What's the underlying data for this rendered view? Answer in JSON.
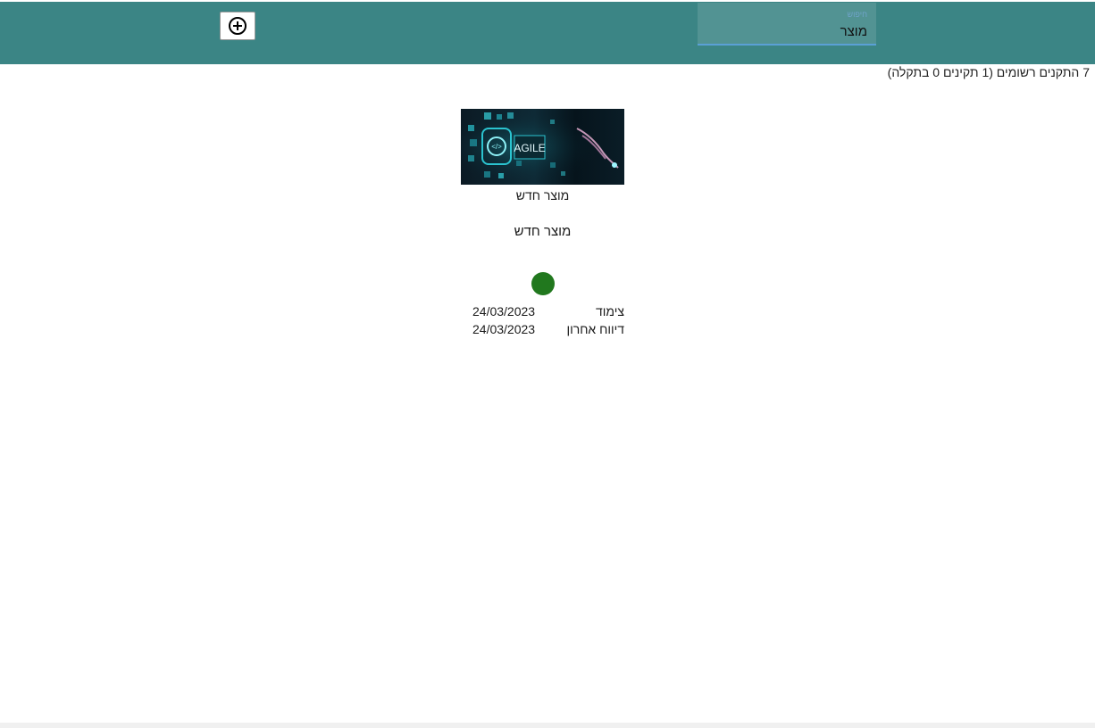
{
  "search": {
    "label": "חיפוש",
    "value": "מוצר"
  },
  "toolbar": {
    "add_icon": "plus-circle-icon"
  },
  "summary": {
    "text": "7 התקנים רשומים (1 תקינים 0 בתקלה)"
  },
  "card": {
    "image_text": "AGILE",
    "image_caption": "מוצר חדש",
    "title": "מוצר חדש",
    "status_color": "#21781e",
    "rows": [
      {
        "label": "צימוד",
        "value": "24/03/2023"
      },
      {
        "label": "דיווח אחרון",
        "value": "24/03/2023"
      }
    ]
  },
  "colors": {
    "header": "#3b8585",
    "accent": "#5aa0d6"
  }
}
